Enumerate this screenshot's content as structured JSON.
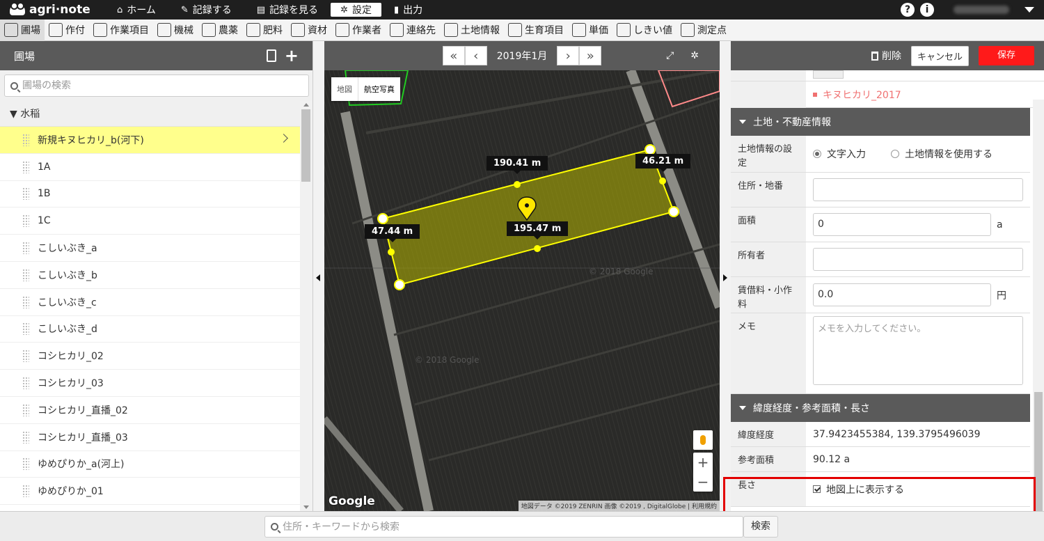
{
  "app": {
    "name": "agri·note"
  },
  "topnav": [
    {
      "label": "ホーム",
      "icon": "home-icon",
      "glyph": "⌂",
      "active": false
    },
    {
      "label": "記録する",
      "icon": "pencil-icon",
      "glyph": "✎",
      "active": false
    },
    {
      "label": "記録を見る",
      "icon": "book-icon",
      "glyph": "▤",
      "active": false
    },
    {
      "label": "設定",
      "icon": "gear-icon",
      "glyph": "✲",
      "active": true
    },
    {
      "label": "出力",
      "icon": "document-icon",
      "glyph": "▮",
      "active": false
    }
  ],
  "categories": [
    {
      "label": "圃場",
      "icon": "pin-icon",
      "active": true
    },
    {
      "label": "作付",
      "icon": "list-icon",
      "active": false
    },
    {
      "label": "作業項目",
      "icon": "work-icon",
      "active": false
    },
    {
      "label": "機械",
      "icon": "tractor-icon",
      "active": false
    },
    {
      "label": "農薬",
      "icon": "flask-icon",
      "active": false
    },
    {
      "label": "肥料",
      "icon": "npk-icon",
      "active": false
    },
    {
      "label": "資材",
      "icon": "wheelbarrow-icon",
      "active": false
    },
    {
      "label": "作業者",
      "icon": "person-icon",
      "active": false
    },
    {
      "label": "連絡先",
      "icon": "phone-icon",
      "active": false
    },
    {
      "label": "土地情報",
      "icon": "land-icon",
      "active": false
    },
    {
      "label": "生育項目",
      "icon": "plant-icon",
      "active": false
    },
    {
      "label": "単価",
      "icon": "yen-icon",
      "active": false
    },
    {
      "label": "しきい値",
      "icon": "chart-icon",
      "active": false
    },
    {
      "label": "測定点",
      "icon": "marker-icon",
      "active": false
    }
  ],
  "left": {
    "title": "圃場",
    "search_placeholder": "圃場の検索",
    "group": "▼ 水稲",
    "items": [
      {
        "label": "新規キヌヒカリ_b(河下)",
        "selected": true
      },
      {
        "label": "1A",
        "selected": false
      },
      {
        "label": "1B",
        "selected": false
      },
      {
        "label": "1C",
        "selected": false
      },
      {
        "label": "こしいぶき_a",
        "selected": false
      },
      {
        "label": "こしいぶき_b",
        "selected": false
      },
      {
        "label": "こしいぶき_c",
        "selected": false
      },
      {
        "label": "こしいぶき_d",
        "selected": false
      },
      {
        "label": "コシヒカリ_02",
        "selected": false
      },
      {
        "label": "コシヒカリ_03",
        "selected": false
      },
      {
        "label": "コシヒカリ_直播_02",
        "selected": false
      },
      {
        "label": "コシヒカリ_直播_03",
        "selected": false
      },
      {
        "label": "ゆめぴりか_a(河上)",
        "selected": false
      },
      {
        "label": "ゆめぴりか_01",
        "selected": false
      }
    ]
  },
  "map": {
    "month": "2019年1月",
    "prev_fast": "«",
    "prev": "‹",
    "next": "›",
    "next_fast": "»",
    "type_map": "地図",
    "type_aerial": "航空写真",
    "lengths": [
      "190.41 m",
      "46.21 m",
      "47.44 m",
      "195.47 m"
    ],
    "google": "Google",
    "attribution": "地図データ ©2019 ZENRIN 画像 ©2019 , DigitalGlobe | 利用規約",
    "zoom_in": "+",
    "zoom_out": "−"
  },
  "right": {
    "delete": "削除",
    "cancel": "キャンセル",
    "save": "保存",
    "crop_tag": "キヌヒカリ_2017",
    "section_land": "土地・不動産情報",
    "land_setting_label": "土地情報の設定",
    "land_option_text": "文字入力",
    "land_option_use": "土地情報を使用する",
    "address_label": "住所・地番",
    "address_value": "",
    "area_label": "面積",
    "area_value": "0",
    "area_unit": "a",
    "owner_label": "所有者",
    "owner_value": "",
    "rent_label": "賃借料・小作料",
    "rent_value": "0.0",
    "rent_unit": "円",
    "memo_label": "メモ",
    "memo_placeholder": "メモを入力してください。",
    "section_geo": "緯度経度・参考面積・長さ",
    "latlng_label": "緯度経度",
    "latlng_value": "37.9423455384, 139.3795496039",
    "ref_area_label": "参考面積",
    "ref_area_value": "90.12 a",
    "length_label": "長さ",
    "length_check_text": "地図上に表示する"
  },
  "bottom": {
    "search_placeholder": "住所・キーワードから検索",
    "search_button": "検索"
  },
  "colors": {
    "save": "#ff1a1a",
    "highlight": "#e30000",
    "selected_row": "#ffff8c",
    "field_polygon": "#e6e600"
  }
}
